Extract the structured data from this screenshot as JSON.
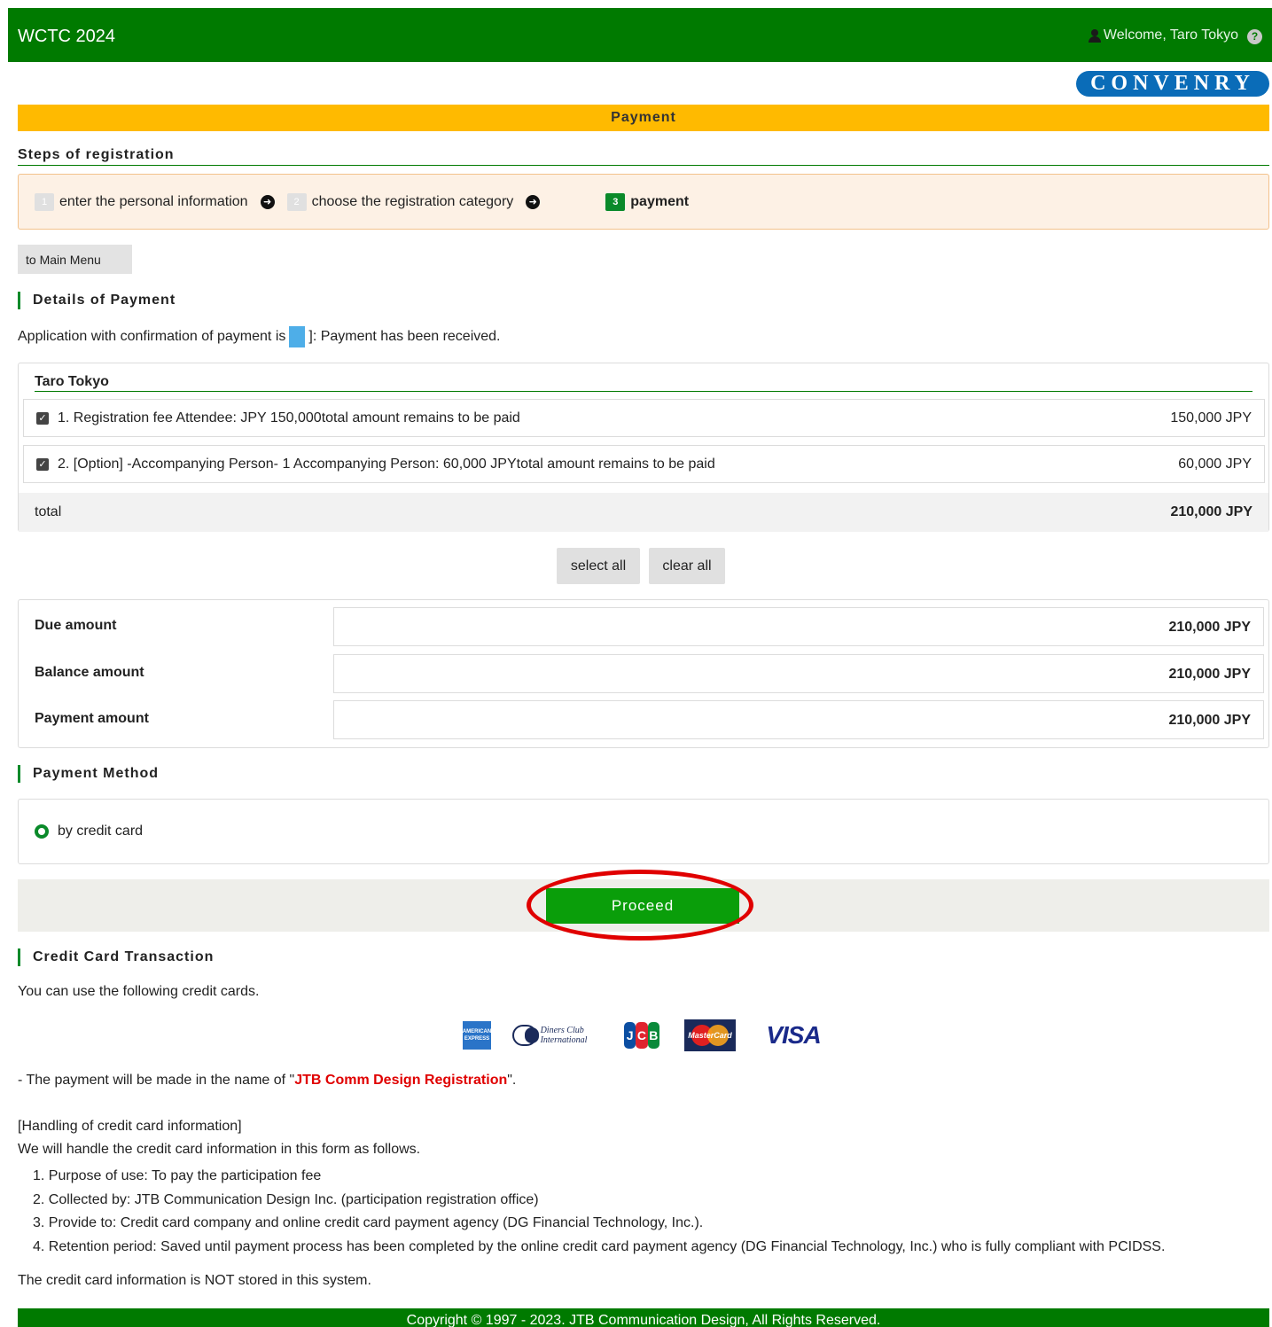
{
  "header": {
    "app_title": "WCTC 2024",
    "welcome": "Welcome, Taro Tokyo",
    "help_icon": "?"
  },
  "brand": {
    "logo_text": "CONVENRY"
  },
  "page": {
    "banner": "Payment"
  },
  "steps": {
    "title": "Steps of registration",
    "items": [
      {
        "num": "1",
        "label": "enter the personal information",
        "active": false
      },
      {
        "num": "2",
        "label": "choose the registration category",
        "active": false
      },
      {
        "num": "3",
        "label": "payment",
        "active": true
      }
    ]
  },
  "nav": {
    "main_menu": "to Main Menu"
  },
  "details": {
    "title": "Details of Payment",
    "note_before": "Application with confirmation of payment is",
    "note_after": "]: Payment has been received.",
    "person": "Taro Tokyo",
    "items": [
      {
        "text": "1.  Registration fee  Attendee: JPY 150,000total amount remains to be paid",
        "amount": "150,000 JPY",
        "checked": true
      },
      {
        "text": "2.  [Option] -Accompanying Person-  1 Accompanying Person: 60,000 JPYtotal amount remains to be paid",
        "amount": "60,000 JPY",
        "checked": true
      }
    ],
    "total_label": "total",
    "total_amount": "210,000 JPY"
  },
  "selection": {
    "select_all": "select all",
    "clear_all": "clear all"
  },
  "amounts": [
    {
      "label": "Due amount",
      "value": "210,000 JPY"
    },
    {
      "label": "Balance amount",
      "value": "210,000 JPY"
    },
    {
      "label": "Payment amount",
      "value": "210,000 JPY"
    }
  ],
  "method": {
    "title": "Payment Method",
    "option": "by credit card",
    "selected": true
  },
  "proceed": {
    "label": "Proceed",
    "highlight_color": "#e00000"
  },
  "credit": {
    "title": "Credit Card Transaction",
    "intro": "You can use the following credit cards.",
    "brands": {
      "amex": "AMERICAN EXPRESS",
      "diners": "Diners Club International",
      "jcb": "JCB",
      "mastercard": "MasterCard",
      "visa": "VISA"
    },
    "name_before": "- The payment will be made in the name of \"",
    "name_value": "JTB Comm Design Registration",
    "name_after": "\".",
    "handling_title": "[Handling of credit card information]",
    "handling_intro": "We will handle the credit card information in this form as follows.",
    "handling_list": [
      "1. Purpose of use: To pay the participation fee",
      "2. Collected by: JTB Communication Design Inc. (participation registration office)",
      "3. Provide to: Credit card company and online credit card payment agency (DG Financial Technology, Inc.).",
      "4. Retention period: Saved until payment process has been completed by the online credit card payment agency (DG Financial Technology, Inc.) who is fully compliant with PCIDSS."
    ],
    "not_stored": "The credit card information is NOT stored in this system."
  },
  "footer": {
    "copyright": "Copyright © 1997 - 2023. JTB Communication Design, All Rights Reserved."
  },
  "colors": {
    "primary_green": "#007a00",
    "banner_yellow": "#ffba00",
    "proceed_green": "#0a9e0a",
    "brand_blue": "#0a6cb8"
  }
}
